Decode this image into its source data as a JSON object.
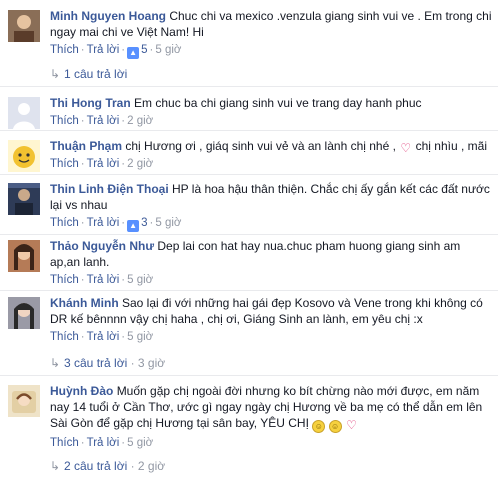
{
  "ui": {
    "reply_label": "Thích",
    "answer_label": "Trả lời",
    "dot": "·",
    "reply_arrow": "↳",
    "like_glyph": "👍"
  },
  "comments": [
    {
      "author": "Minh Nguyen Hoang",
      "text": "Chuc chi va mexico .venzula giang sinh vui ve . Em trong chi ngay mai chi ve Việt Nam! Hi",
      "likes": "5",
      "time": "5 giờ",
      "replies": "1 câu trả lời",
      "avatar_color": "#6d4c41"
    },
    {
      "author": "Thi Hong Tran",
      "text": "Em chuc ba chi giang sinh vui ve trang day hanh phuc",
      "likes": "",
      "time": "2 giờ",
      "replies": "",
      "avatar_color": "#d0d3da"
    },
    {
      "author": "Thuận Phạm",
      "text": "chị Hương ơi , giáq sinh vui vẻ và an lành chị nhé , ",
      "text_tail": " chị nhìu , mãi",
      "likes": "",
      "time": "2 giờ",
      "replies": "",
      "avatar_color": "#f2d04b"
    },
    {
      "author": "Thin Linh Điện Thoại",
      "text": "HP là hoa hậu thân thiện. Chắc chị ấy gắn kết các đất nước lại vs nhau",
      "likes": "3",
      "time": "5 giờ",
      "replies": "",
      "avatar_color": "#3a4a6b"
    },
    {
      "author": "Thảo Nguyễn Như",
      "text": "Dep lai con hat hay nua.chuc pham huong giang sinh am ap,an lanh.",
      "likes": "",
      "time": "5 giờ",
      "replies": "",
      "avatar_color": "#c98d6a"
    },
    {
      "author": "Khánh Minh",
      "text": "Sao lại đi với những hai gái đẹp Kosovo và Vene trong khi không có DR kế bênnnn vậy chị haha , chị ơi, Giáng Sinh an lành, em yêu chị :x",
      "likes": "",
      "time": "5 giờ",
      "replies": "3 câu trả lời",
      "replies_time": "3 giờ",
      "avatar_color": "#8e8e99"
    },
    {
      "author": "Huỳnh Đào",
      "text": "Muốn gặp chị ngoài đời nhưng ko bít chừng nào mới được, em năm nay 14 tuổi ở Cần Thơ, ước gì ngay ngày chị Hương về ba mẹ có thể dẫn em lên Sài Gòn để gặp chị Hương tại sân bay, YÊU CHỊ",
      "likes": "",
      "time": "5 giờ",
      "replies": "2 câu trả lời",
      "replies_time": "2 giờ",
      "avatar_color": "#d9c7a3"
    }
  ],
  "emoji": {
    "heart": "♡",
    "smile": "☺"
  }
}
